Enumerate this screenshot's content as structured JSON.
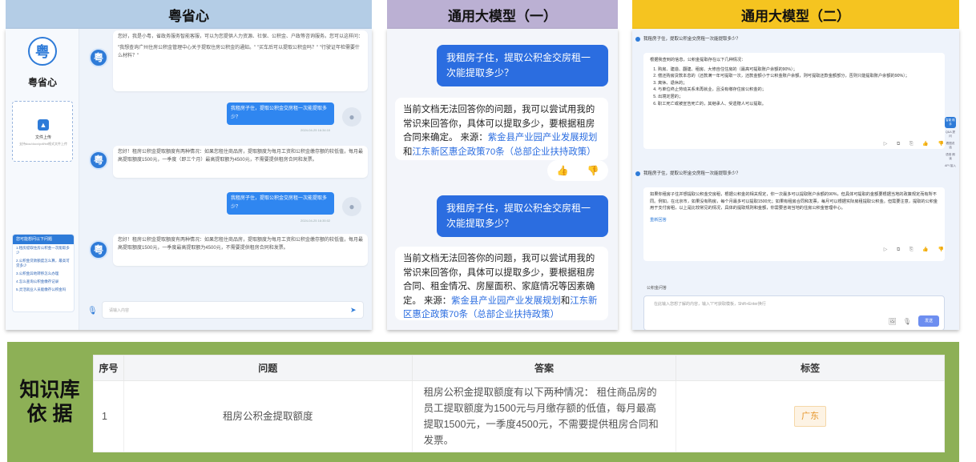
{
  "panels": {
    "p1": {
      "title": "粤省心",
      "app_name": "粤省心",
      "logo_glyph": "粤",
      "upload_label": "文件上传",
      "upload_hint": "支持doc/docx/pdf/txt格式文件上传",
      "faq_title": "您可能想问以下问题",
      "faq_items": [
        "1.租房提取住房公积金一次能取多少",
        "2.公积金贷款额度怎么算，最高可贷多少",
        "3.公积金异地转移怎么办理",
        "4.怎么查询公积金缴存记录",
        "5.灵活就业人员能缴存公积金吗"
      ],
      "greeting": "您好，我是小粤，省政务服务智能客服，可以为您提供人力资源、社保、公积金、户政等咨询服务。您可以这样问：",
      "greeting_examples": "\"我想查询广州住房公积金管理中心关于提取住房公积金的通知。\"  \"买车后可以提取公积金吗？\"  \"行驶证年检需要什么材料？\"",
      "user_q": "我租房子住，提取公积金交房租一次能提取多少？",
      "ts1": "2024-04-25 16:34:10",
      "answer1": "您好！租房公积金提取额度有两种情况：如果您租住商品房，提取额度为每月工资和公积金缴存额的较低值，每月最高提取额度1500元，一季度（即三个月）最高提取额为4500元，不需要提供租房合同和发票。",
      "ts2": "2024-04-25 16:35:02",
      "answer2": "您好！租房公积金提取额度有两种情况：如果您租住商品房，提取额度为每月工资和公积金缴存额的较低值，每月最高提取额度1500元，一季度最高提取额为4500元，不需要提供租房合同和发票。",
      "input_placeholder": "请输入内容"
    },
    "p2": {
      "title": "通用大模型（一）",
      "user_q": "我租房子住，提取公积金交房租一次能提取多少？",
      "answer1_text": "当前文档无法回答你的问题，我可以尝试用我的常识来回答你，具体可以提取多少，要根据租房合同来确定。 来源：",
      "answer1_link1": "紫金县产业园产业发展规划",
      "answer1_and": "和",
      "answer1_link2": "江东新区惠企政策70条（总部企业扶持政策）",
      "user_q2": "我租房子住，提取公积金交房租一次能提取多少？",
      "answer2_text": "当前文档无法回答你的问题，我可以尝试用我的常识来回答你，具体可以提取多少，要根据租房合同、租金情况、房屋面积、家庭情况等因素确定。 来源：",
      "answer2_link1": "紫金县产业园产业发展规划",
      "answer2_and": "和",
      "answer2_link2": "江东新区惠企政策70条（总部企业扶持政策）"
    },
    "p3": {
      "title": "通用大模型（二）",
      "q1": "我租房子住，提取公积金交房租一次能提取多少？",
      "a1_intro": "根据我查到的信息，公积金提取存在以下几种情况：",
      "a1_items": [
        "购房、建造、翻建、租房、大修自住住房的（最高可提取账户余额的90%）；",
        "偿还购房贷款本息的（还款满一年可提取一次，还款金额小于公积金账户余额，则可提取还款金额部分，否则只能提取账户余额的90%）；",
        "离休、退休的；",
        "与单位终止劳动关系未再就业，且没有缴存住房公积金的；",
        "出境定居的；",
        "职工死亡或被宣告死亡的，其继承人、受遗赠人可以提取。"
      ],
      "q2": "我租房子住，提取公积金交房租一次能提取多少？",
      "a2": "如果你租房子住并想提取公积金交房租，根据公积金的相关规定，你一次最多可以提取账户余额的90%，但具体可提取的金额要根据当地的政策规定而有所不同。例如，在北京市，如果没有购房，每个月最多可以提取1500元；如果有租房合同和发票，每月可以根据实际房租提取公积金。但需要注意，提取的公积金用于支付房租，以上是比较常见的情况，具体的提取规则和金额，你需要咨询当地的住房公积金管理中心。",
      "regen_label": "重新回答",
      "kb_label": "公积金问答",
      "input_placeholder": "在此输入您想了解的内容，输入\"/\"可获取模板，Shift+Enter换行",
      "send_label": "发送",
      "side_items": [
        "Q&A 提问",
        "看图说话",
        "语音 朗读",
        "API 接入"
      ],
      "side_highlight": "智能 助手"
    }
  },
  "knowledge_base": {
    "title_line1": "知识库",
    "title_line2": "依 据",
    "columns": [
      "序号",
      "问题",
      "答案",
      "标签"
    ],
    "rows": [
      {
        "index": "1",
        "question": "租房公积金提取额度",
        "answer": "租房公积金提取额度有以下两种情况： 租住商品房的员工提取额度为1500元与月缴存额的低值，每月最高提取1500元，一季度4500元，不需要提供租房合同和发票。",
        "tag": "广东"
      }
    ]
  }
}
